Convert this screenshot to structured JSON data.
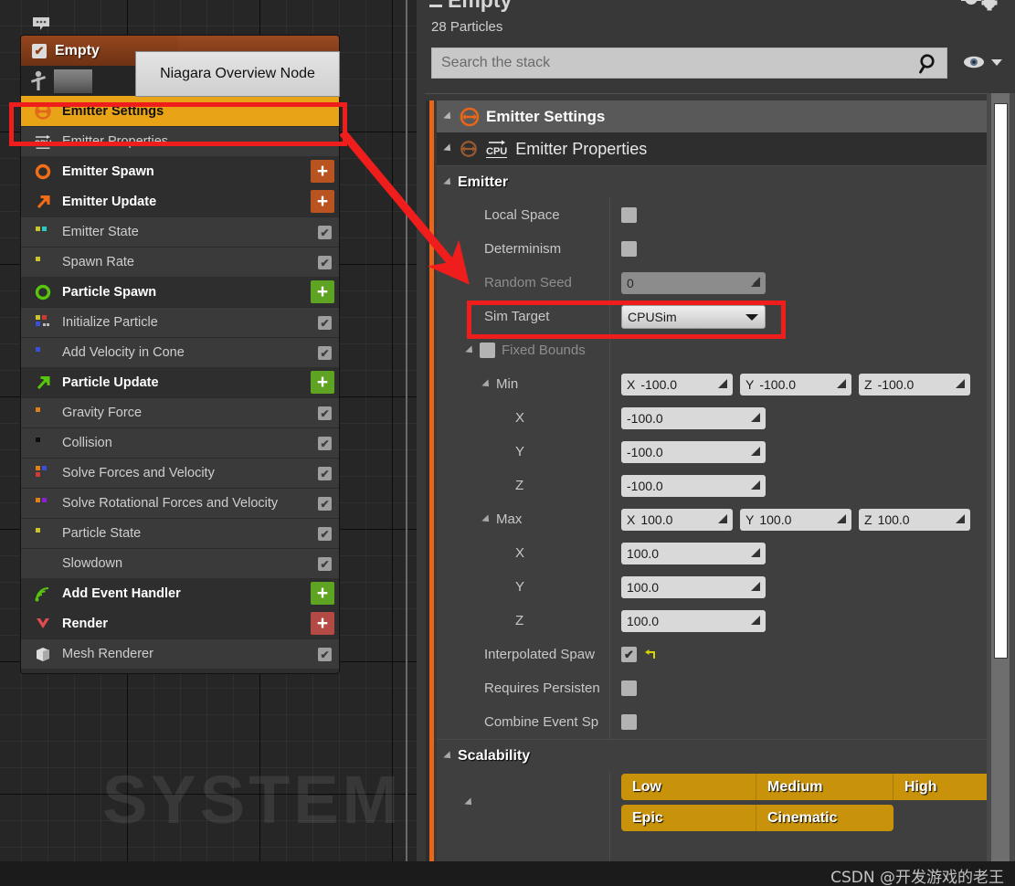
{
  "graph": {
    "watermark": "SYSTEM",
    "comment_icon": "comment-bubble-icon",
    "tooltip": "Niagara Overview Node",
    "node": {
      "title": "Empty",
      "enabled": true,
      "stack": [
        {
          "label": "Emitter Settings",
          "type": "group",
          "icon": "emitter-settings-icon",
          "selected": true,
          "action": null
        },
        {
          "label": "Emitter Properties",
          "type": "module",
          "icon": "cpu-icon",
          "checkbox": null
        },
        {
          "label": "Emitter Spawn",
          "type": "group",
          "icon": "circle-orange-icon",
          "action": "add",
          "action_color": "#b9531f"
        },
        {
          "label": "Emitter Update",
          "type": "group",
          "icon": "arrow-orange-icon",
          "action": "add",
          "action_color": "#b9531f"
        },
        {
          "label": "Emitter State",
          "type": "module",
          "icon": "squares-green-cyan-icon",
          "checkbox": true
        },
        {
          "label": "Spawn Rate",
          "type": "module",
          "icon": "square-yellow-icon",
          "checkbox": true
        },
        {
          "label": "Particle Spawn",
          "type": "group",
          "icon": "circle-green-icon",
          "action": "add",
          "action_color": "#5fa322"
        },
        {
          "label": "Initialize Particle",
          "type": "module",
          "icon": "squares-multi-icon",
          "checkbox": true
        },
        {
          "label": "Add Velocity in Cone",
          "type": "module",
          "icon": "square-blue-icon",
          "checkbox": true
        },
        {
          "label": "Particle Update",
          "type": "group",
          "icon": "arrow-green-icon",
          "action": "add",
          "action_color": "#5fa322"
        },
        {
          "label": "Gravity Force",
          "type": "module",
          "icon": "square-orange-icon",
          "checkbox": true
        },
        {
          "label": "Collision",
          "type": "module",
          "icon": "square-black-icon",
          "checkbox": true
        },
        {
          "label": "Solve Forces and Velocity",
          "type": "module",
          "icon": "squares-orange-blue-red-icon",
          "checkbox": true
        },
        {
          "label": "Solve Rotational Forces and Velocity",
          "type": "module",
          "icon": "squares-orange-purple-icon",
          "checkbox": true
        },
        {
          "label": "Particle State",
          "type": "module",
          "icon": "square-yellow-icon",
          "checkbox": true
        },
        {
          "label": "Slowdown",
          "type": "module",
          "icon": "none-icon",
          "checkbox": true
        },
        {
          "label": "Add Event Handler",
          "type": "group",
          "icon": "event-waves-icon",
          "action": "add",
          "action_color": "#5fa322"
        },
        {
          "label": "Render",
          "type": "group",
          "icon": "render-chevron-icon",
          "action": "add",
          "action_color": "#b44a46"
        },
        {
          "label": "Mesh Renderer",
          "type": "module",
          "icon": "mesh-cube-icon",
          "checkbox": true
        }
      ]
    }
  },
  "details": {
    "title": "Empty",
    "particle_count": "28 Particles",
    "search": {
      "placeholder": "Search the stack",
      "value": ""
    },
    "section": "Emitter Settings",
    "module": "Emitter Properties",
    "module_badge": "CPU",
    "category": "Emitter",
    "rows": [
      {
        "name": "Local Space",
        "kind": "checkbox",
        "value": false,
        "dim": false,
        "indent": 1
      },
      {
        "name": "Determinism",
        "kind": "checkbox",
        "value": false,
        "dim": false,
        "indent": 1
      },
      {
        "name": "Random Seed",
        "kind": "text",
        "value": "0",
        "dim": true,
        "indent": 1,
        "disabled": true
      },
      {
        "name": "Sim Target",
        "kind": "dropdown",
        "value": "CPUSim",
        "dim": false,
        "indent": 1
      },
      {
        "name": "Fixed Bounds",
        "kind": "group-checkbox",
        "value": false,
        "dim": true,
        "indent": 1
      },
      {
        "name": "Min",
        "kind": "vector",
        "value": {
          "x": "-100.0",
          "y": "-100.0",
          "z": "-100.0"
        },
        "indent": 2
      },
      {
        "name": "X",
        "kind": "number",
        "value": "-100.0",
        "indent": 3
      },
      {
        "name": "Y",
        "kind": "number",
        "value": "-100.0",
        "indent": 3
      },
      {
        "name": "Z",
        "kind": "number",
        "value": "-100.0",
        "indent": 3
      },
      {
        "name": "Max",
        "kind": "vector",
        "value": {
          "x": "100.0",
          "y": "100.0",
          "z": "100.0"
        },
        "indent": 2
      },
      {
        "name": "X",
        "kind": "number",
        "value": "100.0",
        "indent": 3
      },
      {
        "name": "Y",
        "kind": "number",
        "value": "100.0",
        "indent": 3
      },
      {
        "name": "Z",
        "kind": "number",
        "value": "100.0",
        "indent": 3
      },
      {
        "name": "Interpolated Spaw",
        "kind": "checkbox-reset",
        "value": true,
        "indent": 1
      },
      {
        "name": "Requires Persisten",
        "kind": "checkbox",
        "value": false,
        "indent": 1
      },
      {
        "name": "Combine Event Sp",
        "kind": "checkbox",
        "value": false,
        "indent": 1
      }
    ],
    "scalability": {
      "label": "Scalability",
      "row1": [
        "Low",
        "Medium",
        "High"
      ],
      "row2": [
        "Epic",
        "Cinematic"
      ]
    },
    "axis_labels": {
      "x": "X",
      "y": "Y",
      "z": "Z"
    },
    "dropdown_value": "CPUSim",
    "eye_icon": "eye-visibility-icon",
    "search_icon": "search-icon",
    "gear_icon": "gear-icon"
  },
  "annotations": {
    "highlight_emitter_settings": "#f01d1d",
    "highlight_sim_target": "#f01d1d",
    "arrow_color": "#f01d1d"
  },
  "watermark": "CSDN @开发游戏的老王",
  "colors": {
    "accent_orange": "#e8661a",
    "selection_gold": "#e8a317",
    "scalability_gold": "#c8930b",
    "node_header": "#8f4018",
    "annotation_red": "#f01d1d"
  }
}
